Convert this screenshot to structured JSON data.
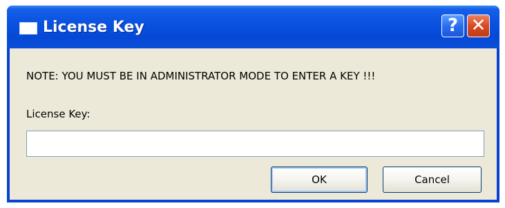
{
  "window": {
    "title": "License Key",
    "help_glyph": "?",
    "close_glyph": "✕"
  },
  "dialog": {
    "note": "NOTE: YOU MUST BE IN ADMINISTRATOR MODE TO ENTER A KEY !!!",
    "license_label": "License Key:",
    "license_value": "",
    "ok_label": "OK",
    "cancel_label": "Cancel"
  },
  "icons": {
    "title": "window-icon",
    "help": "help-icon",
    "close": "close-icon"
  },
  "colors": {
    "titlebar": "#0a52e0",
    "client": "#ece9d8",
    "close_button": "#d84a22"
  }
}
